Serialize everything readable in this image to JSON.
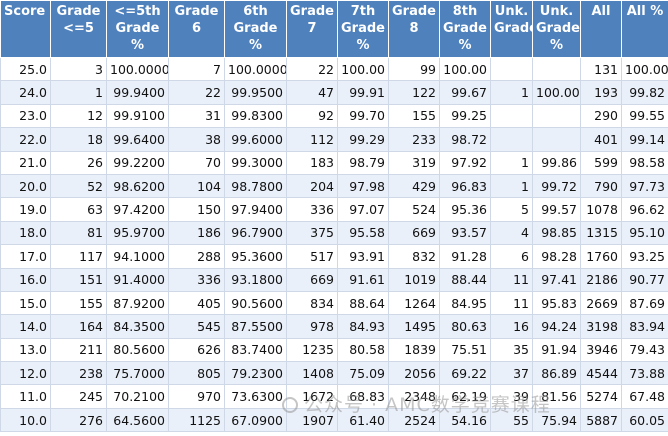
{
  "headers": [
    "Score",
    "Grade <=5",
    "<=5th Grade %",
    "Grade 6",
    "6th Grade %",
    "Grade 7",
    "7th Grade %",
    "Grade 8",
    "8th Grade %",
    "Unk. Grade",
    "Unk. Grade %",
    "All",
    "All %"
  ],
  "rows": [
    [
      "25.0",
      "3",
      "100.0000",
      "7",
      "100.0000",
      "22",
      "100.00",
      "99",
      "100.00",
      "",
      "",
      "131",
      "100.00"
    ],
    [
      "24.0",
      "1",
      "99.9400",
      "22",
      "99.9500",
      "47",
      "99.91",
      "122",
      "99.67",
      "1",
      "100.00",
      "193",
      "99.82"
    ],
    [
      "23.0",
      "12",
      "99.9100",
      "31",
      "99.8300",
      "92",
      "99.70",
      "155",
      "99.25",
      "",
      "",
      "290",
      "99.55"
    ],
    [
      "22.0",
      "18",
      "99.6400",
      "38",
      "99.6000",
      "112",
      "99.29",
      "233",
      "98.72",
      "",
      "",
      "401",
      "99.14"
    ],
    [
      "21.0",
      "26",
      "99.2200",
      "70",
      "99.3000",
      "183",
      "98.79",
      "319",
      "97.92",
      "1",
      "99.86",
      "599",
      "98.58"
    ],
    [
      "20.0",
      "52",
      "98.6200",
      "104",
      "98.7800",
      "204",
      "97.98",
      "429",
      "96.83",
      "1",
      "99.72",
      "790",
      "97.73"
    ],
    [
      "19.0",
      "63",
      "97.4200",
      "150",
      "97.9400",
      "336",
      "97.07",
      "524",
      "95.36",
      "5",
      "99.57",
      "1078",
      "96.62"
    ],
    [
      "18.0",
      "81",
      "95.9700",
      "186",
      "96.7900",
      "375",
      "95.58",
      "669",
      "93.57",
      "4",
      "98.85",
      "1315",
      "95.10"
    ],
    [
      "17.0",
      "117",
      "94.1000",
      "288",
      "95.3600",
      "517",
      "93.91",
      "832",
      "91.28",
      "6",
      "98.28",
      "1760",
      "93.25"
    ],
    [
      "16.0",
      "151",
      "91.4000",
      "336",
      "93.1800",
      "669",
      "91.61",
      "1019",
      "88.44",
      "11",
      "97.41",
      "2186",
      "90.77"
    ],
    [
      "15.0",
      "155",
      "87.9200",
      "405",
      "90.5600",
      "834",
      "88.64",
      "1264",
      "84.95",
      "11",
      "95.83",
      "2669",
      "87.69"
    ],
    [
      "14.0",
      "164",
      "84.3500",
      "545",
      "87.5500",
      "978",
      "84.93",
      "1495",
      "80.63",
      "16",
      "94.24",
      "3198",
      "83.94"
    ],
    [
      "13.0",
      "211",
      "80.5600",
      "626",
      "83.7400",
      "1235",
      "80.58",
      "1839",
      "75.51",
      "35",
      "91.94",
      "3946",
      "79.43"
    ],
    [
      "12.0",
      "238",
      "75.7000",
      "805",
      "79.2300",
      "1408",
      "75.09",
      "2056",
      "69.22",
      "37",
      "86.89",
      "4544",
      "73.88"
    ],
    [
      "11.0",
      "245",
      "70.2100",
      "970",
      "73.6300",
      "1672",
      "68.83",
      "2348",
      "62.19",
      "39",
      "81.56",
      "5274",
      "67.48"
    ],
    [
      "10.0",
      "276",
      "64.5600",
      "1125",
      "67.0900",
      "1907",
      "61.40",
      "2524",
      "54.16",
      "55",
      "75.94",
      "5887",
      "60.05"
    ]
  ],
  "watermark": "公众号 · AMC数学竞赛课程"
}
